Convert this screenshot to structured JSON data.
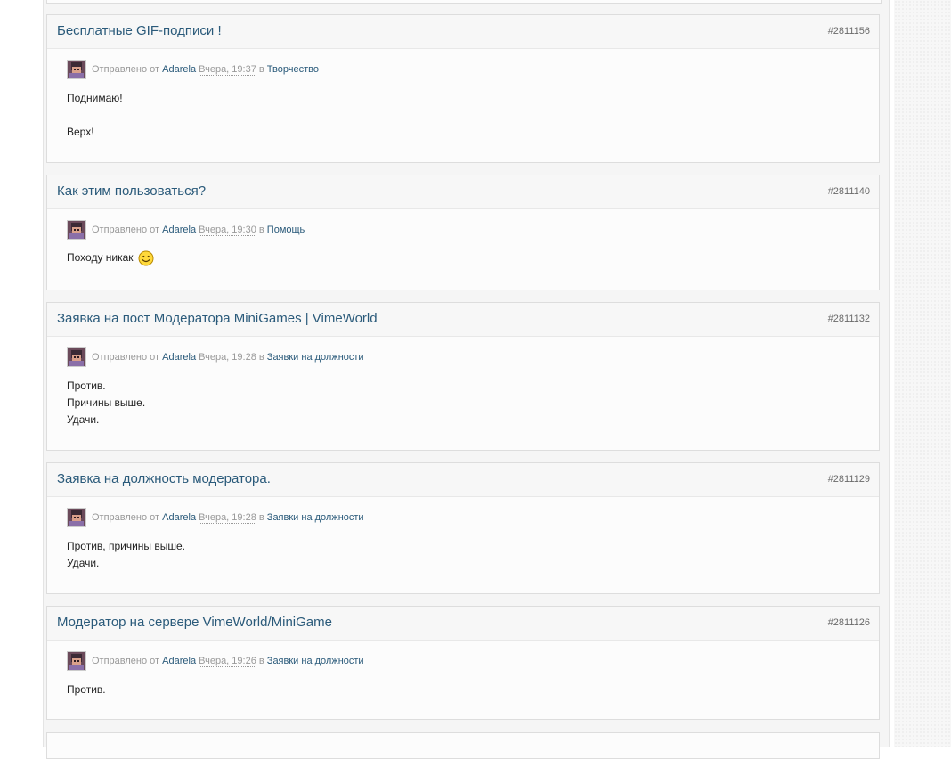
{
  "posts": [
    {
      "title": "Бесплатные GIF-подписи !",
      "id": "#2811156",
      "sent_label": "Отправлено от",
      "author": "Adarela",
      "date": "Вчера, 19:37",
      "in_label": "в",
      "forum": "Творчество",
      "body_1": "Поднимаю!",
      "body_2": "Верх!"
    },
    {
      "title": "Как этим пользоваться?",
      "id": "#2811140",
      "sent_label": "Отправлено от",
      "author": "Adarela",
      "date": "Вчера, 19:30",
      "in_label": "в",
      "forum": "Помощь",
      "body_1": "Походу никак"
    },
    {
      "title": "Заявка на пост Модератора MiniGames | VimeWorld",
      "id": "#2811132",
      "sent_label": "Отправлено от",
      "author": "Adarela",
      "date": "Вчера, 19:28",
      "in_label": "в",
      "forum": "Заявки на должности",
      "body_1": "Против.",
      "body_2": "Причины выше.",
      "body_3": "Удачи."
    },
    {
      "title": "Заявка на должность модератора.",
      "id": "#2811129",
      "sent_label": "Отправлено от",
      "author": "Adarela",
      "date": "Вчера, 19:28",
      "in_label": "в",
      "forum": "Заявки на должности",
      "body_1": "Против, причины выше.",
      "body_2": "Удачи."
    },
    {
      "title": "Модератор на сервере VimeWorld/MiniGame",
      "id": "#2811126",
      "sent_label": "Отправлено от",
      "author": "Adarela",
      "date": "Вчера, 19:26",
      "in_label": "в",
      "forum": "Заявки на должности",
      "body_1": "Против."
    }
  ],
  "icons": {
    "avatar": "avatar-icon",
    "smiley": "smiley-icon"
  },
  "colors": {
    "link": "#2a5a7a",
    "meta_text": "#999999",
    "post_bg": "#fcfcfc",
    "border": "#dddddd"
  }
}
